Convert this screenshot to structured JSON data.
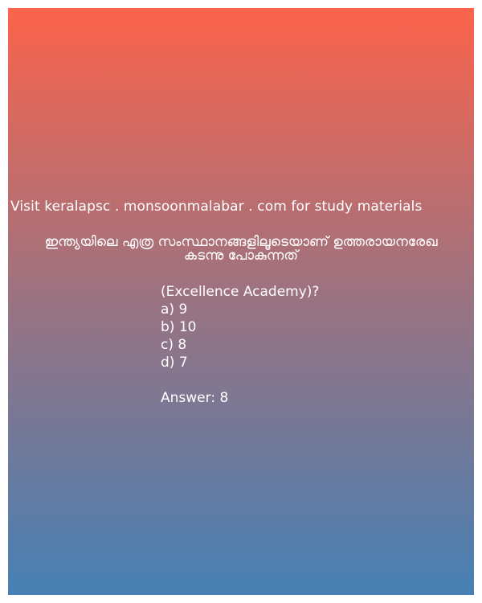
{
  "site_line": "Visit keralapsc . monsoonmalabar . com for study materials",
  "question": {
    "line1": "ഇന്ത്യയിലെ എത്ര സംസ്ഥാനങ്ങളിലൂടെയാണ് ഉത്തരായനരേഖ",
    "line2": "കടന്നു പോകുന്നത്"
  },
  "source": "(Excellence Academy)?",
  "options": {
    "a": "a) 9",
    "b": "b) 10",
    "c": "c) 8",
    "d": "d) 7"
  },
  "answer": "Answer: 8",
  "colors": {
    "gradient_top": "#fc634b",
    "gradient_mid": "#9a7382",
    "gradient_bottom": "#4680b4",
    "text": "#ffffff"
  }
}
